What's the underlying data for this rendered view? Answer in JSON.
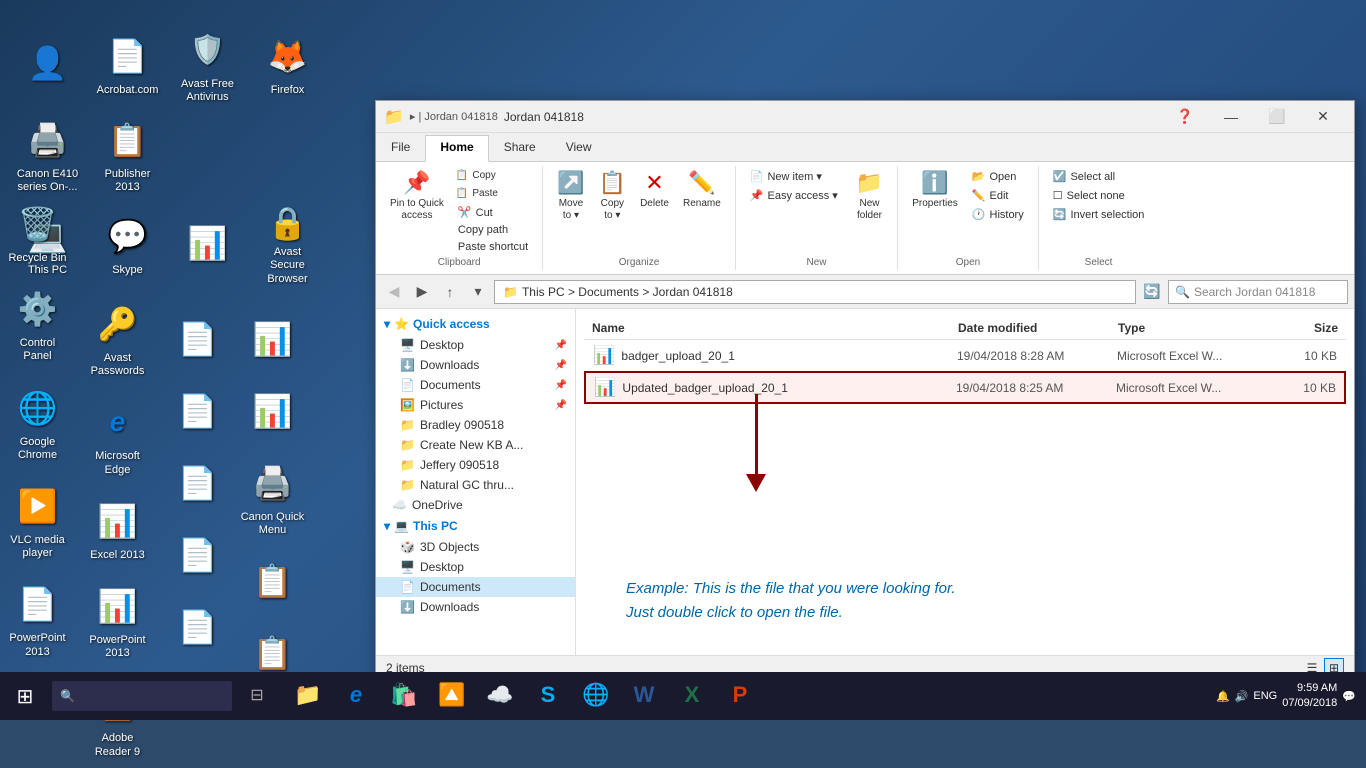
{
  "desktop": {
    "icons": [
      {
        "id": "user-profile",
        "label": "",
        "icon": "👤",
        "color": "#4a9fd4"
      },
      {
        "id": "acrobat",
        "label": "Acrobat.com",
        "icon": "📄",
        "color": "#cc0000"
      },
      {
        "id": "avast",
        "label": "Avast Free Antivirus",
        "icon": "🛡️",
        "color": "#f0a500"
      },
      {
        "id": "firefox",
        "label": "Firefox",
        "icon": "🦊",
        "color": "#ff6611"
      },
      {
        "id": "canon-e410",
        "label": "Canon E410 series On-...",
        "icon": "🖨️",
        "color": "#333"
      },
      {
        "id": "publisher2013",
        "label": "Publisher 2013",
        "icon": "📋",
        "color": "#1e7145"
      },
      {
        "id": "this-pc",
        "label": "This PC",
        "icon": "💻",
        "color": "#4a9fd4"
      },
      {
        "id": "skype",
        "label": "Skype",
        "icon": "💬",
        "color": "#00aff0"
      },
      {
        "id": "avast-secure",
        "label": "Avast Secure Browser",
        "icon": "🔒",
        "color": "#f0a500"
      },
      {
        "id": "recycle-bin",
        "label": "Recycle Bin",
        "icon": "🗑️",
        "color": "#555"
      },
      {
        "id": "control-panel",
        "label": "Control Panel",
        "icon": "⚙️",
        "color": "#555"
      },
      {
        "id": "avast-passwords",
        "label": "Avast Passwords",
        "icon": "🔑",
        "color": "#f0a500"
      },
      {
        "id": "google-chrome",
        "label": "Google Chrome",
        "icon": "🌐",
        "color": "#4285f4"
      },
      {
        "id": "ms-edge",
        "label": "Microsoft Edge",
        "icon": "🌐",
        "color": "#0078d7"
      },
      {
        "id": "canon-quick-menu",
        "label": "Canon Quick Menu",
        "icon": "🖨️",
        "color": "#333"
      },
      {
        "id": "vlc",
        "label": "VLC media player",
        "icon": "▶️",
        "color": "#f60"
      },
      {
        "id": "excel2013",
        "label": "Excel 2013",
        "icon": "📊",
        "color": "#1e7145"
      },
      {
        "id": "powerpoint2013-1",
        "label": "PowerPoint 2013",
        "icon": "📊",
        "color": "#d04000"
      },
      {
        "id": "adobe-reader",
        "label": "Adobe Reader 9",
        "icon": "📄",
        "color": "#cc0000"
      },
      {
        "id": "powerpoint2013-2",
        "label": "PowerPoint 2013",
        "icon": "📋",
        "color": "#d04000"
      },
      {
        "id": "publisher2013-2",
        "label": "Publisher 2013",
        "icon": "📋",
        "color": "#1e7145"
      }
    ]
  },
  "taskbar": {
    "start_label": "⊞",
    "search_placeholder": "🔍",
    "time": "9:59 AM",
    "date": "07/09/2018",
    "language": "ENG",
    "apps": [
      {
        "id": "task-view",
        "icon": "⊟"
      },
      {
        "id": "file-explorer",
        "icon": "📁"
      },
      {
        "id": "edge",
        "icon": "e"
      },
      {
        "id": "windows-store",
        "icon": "🛍️"
      },
      {
        "id": "settings",
        "icon": "⚙️"
      },
      {
        "id": "upwork",
        "icon": "🔼"
      },
      {
        "id": "icloud",
        "icon": "☁️"
      },
      {
        "id": "skype-app",
        "icon": "S"
      },
      {
        "id": "chrome-app",
        "icon": "🌐"
      },
      {
        "id": "word-app",
        "icon": "W"
      },
      {
        "id": "excel-app",
        "icon": "X"
      },
      {
        "id": "ppt-app",
        "icon": "P"
      }
    ]
  },
  "explorer": {
    "title": "Jordan 041818",
    "tabs": [
      "File",
      "Home",
      "Share",
      "View"
    ],
    "active_tab": "Home",
    "ribbon": {
      "clipboard": {
        "label": "Clipboard",
        "buttons": [
          {
            "id": "pin-to-quick-access",
            "label": "Pin to Quick\naccess",
            "icon": "📌"
          },
          {
            "id": "copy-btn",
            "label": "Copy",
            "icon": "📋"
          },
          {
            "id": "paste-btn",
            "label": "Paste",
            "icon": "📋"
          },
          {
            "id": "cut",
            "label": "Cut",
            "icon": "✂️"
          },
          {
            "id": "copy-path",
            "label": "Copy path",
            "icon": ""
          },
          {
            "id": "paste-shortcut",
            "label": "Paste shortcut",
            "icon": ""
          }
        ]
      },
      "organize": {
        "label": "Organize",
        "buttons": [
          {
            "id": "move-to",
            "label": "Move\nto ▾",
            "icon": "↗️"
          },
          {
            "id": "copy-to",
            "label": "Copy\nto ▾",
            "icon": "📋"
          },
          {
            "id": "delete",
            "label": "Delete",
            "icon": "✕"
          },
          {
            "id": "rename",
            "label": "Rename",
            "icon": "✏️"
          }
        ]
      },
      "new": {
        "label": "New",
        "buttons": [
          {
            "id": "new-item",
            "label": "New item ▾",
            "icon": ""
          },
          {
            "id": "easy-access",
            "label": "Easy access ▾",
            "icon": ""
          },
          {
            "id": "new-folder",
            "label": "New\nfolder",
            "icon": "📁"
          }
        ]
      },
      "open": {
        "label": "Open",
        "buttons": [
          {
            "id": "properties",
            "label": "Properties",
            "icon": "ℹ️"
          },
          {
            "id": "open-btn",
            "label": "Open",
            "icon": ""
          },
          {
            "id": "edit-btn",
            "label": "Edit",
            "icon": ""
          },
          {
            "id": "history",
            "label": "History",
            "icon": ""
          }
        ]
      },
      "select": {
        "label": "Select",
        "buttons": [
          {
            "id": "select-all",
            "label": "Select all",
            "icon": ""
          },
          {
            "id": "select-none",
            "label": "Select none",
            "icon": ""
          },
          {
            "id": "invert-selection",
            "label": "Invert selection",
            "icon": ""
          }
        ]
      }
    },
    "address": {
      "path": "This PC > Documents > Jordan 041818",
      "search_placeholder": "Search Jordan 041818"
    },
    "nav_pane": {
      "quick_access": {
        "label": "Quick access",
        "items": [
          {
            "id": "desktop",
            "label": "Desktop",
            "pinned": true
          },
          {
            "id": "downloads",
            "label": "Downloads",
            "pinned": true
          },
          {
            "id": "documents",
            "label": "Documents",
            "pinned": true
          },
          {
            "id": "pictures",
            "label": "Pictures",
            "pinned": true
          }
        ]
      },
      "other_items": [
        {
          "id": "bradley",
          "label": "Bradley 090518"
        },
        {
          "id": "create-new",
          "label": "Create New KB A..."
        },
        {
          "id": "jeffery",
          "label": "Jeffery 090518"
        },
        {
          "id": "natural-gc",
          "label": "Natural GC thru..."
        }
      ],
      "one-drive": {
        "label": "OneDrive"
      },
      "this-pc": {
        "label": "This PC",
        "items": [
          {
            "id": "3d-objects",
            "label": "3D Objects"
          },
          {
            "id": "desktop-pc",
            "label": "Desktop"
          },
          {
            "id": "documents-pc",
            "label": "Documents",
            "active": true
          },
          {
            "id": "downloads-pc",
            "label": "Downloads"
          }
        ]
      }
    },
    "file_list": {
      "headers": [
        "Name",
        "Date modified",
        "Type",
        "Size"
      ],
      "files": [
        {
          "id": "badger-upload",
          "name": "badger_upload_20_1",
          "date": "19/04/2018 8:28 AM",
          "type": "Microsoft Excel W...",
          "size": "10 KB",
          "selected": false
        },
        {
          "id": "updated-badger",
          "name": "Updated_badger_upload_20_1",
          "date": "19/04/2018 8:25 AM",
          "type": "Microsoft Excel W...",
          "size": "10 KB",
          "selected": true,
          "highlighted": true
        }
      ]
    },
    "status": "2 items",
    "annotation": {
      "text": "Example: This is the file that you were looking for.\nJust double click to open the file."
    }
  }
}
